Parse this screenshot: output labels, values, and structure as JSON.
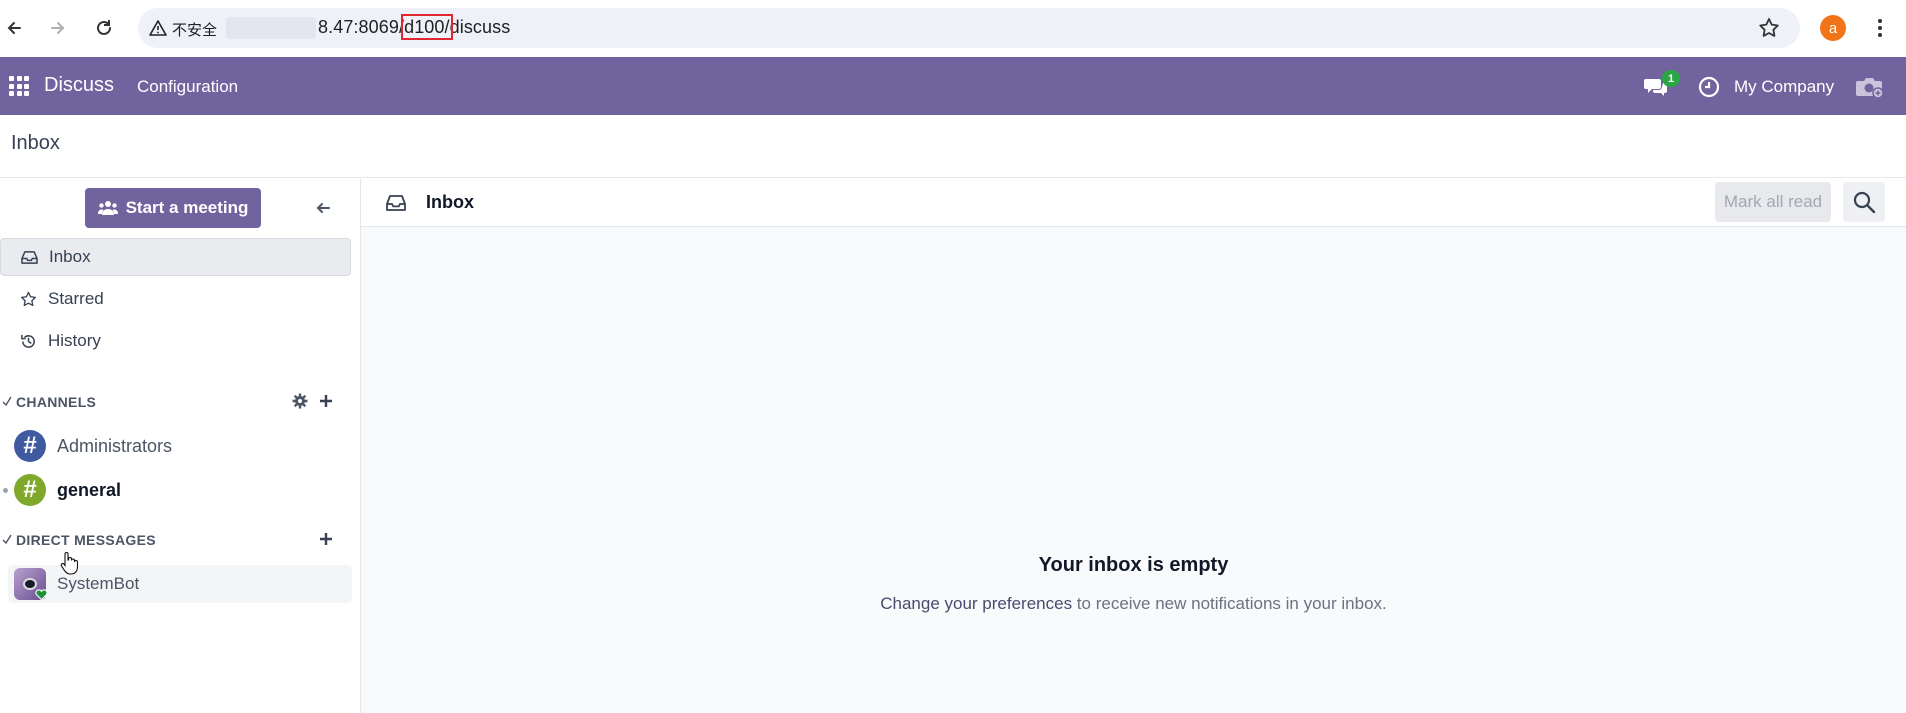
{
  "browser": {
    "insecure_label": "不安全",
    "url_prefix": "8.47:8069/",
    "url_highlight": "d100/",
    "url_suffix": "discuss",
    "profile_initial": "a"
  },
  "navbar": {
    "app_name": "Discuss",
    "menu_configuration": "Configuration",
    "chat_badge": "1",
    "company": "My Company",
    "color": "#71639e"
  },
  "control": {
    "breadcrumb": "Inbox"
  },
  "sidebar": {
    "start_meeting": "Start a meeting",
    "mailboxes": [
      {
        "label": "Inbox",
        "icon": "inbox-icon",
        "active": true
      },
      {
        "label": "Starred",
        "icon": "star-outline-icon",
        "active": false
      },
      {
        "label": "History",
        "icon": "history-icon",
        "active": false
      }
    ],
    "channels_title": "CHANNELS",
    "channels": [
      {
        "name": "Administrators",
        "color": "#3f5a9f",
        "unread": false
      },
      {
        "name": "general",
        "color": "#80a92c",
        "unread": true
      }
    ],
    "dm_title": "DIRECT MESSAGES",
    "direct_messages": [
      {
        "name": "SystemBot",
        "status": "online"
      }
    ]
  },
  "main": {
    "title": "Inbox",
    "mark_all_read": "Mark all read",
    "empty_title": "Your inbox is empty",
    "empty_link": "Change your preferences",
    "empty_rest": " to receive new notifications in your inbox."
  }
}
